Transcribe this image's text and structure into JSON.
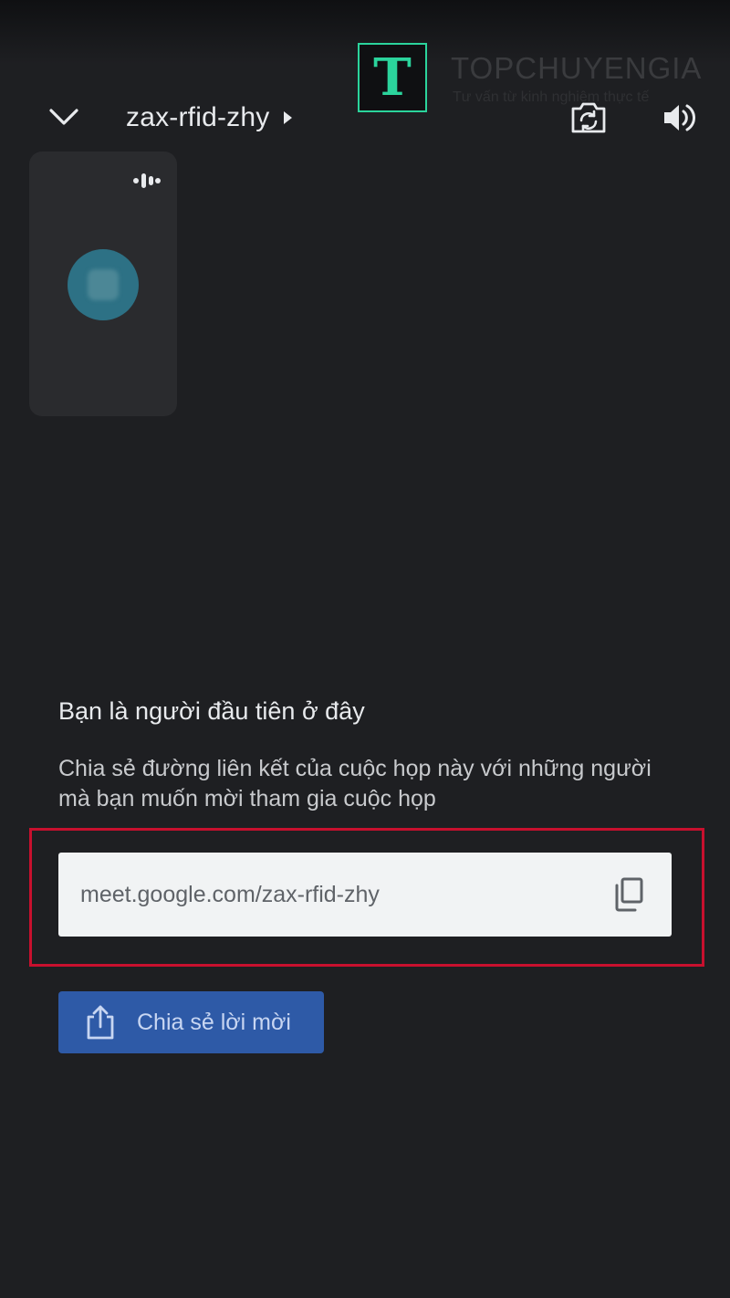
{
  "header": {
    "meeting_code": "zax-rfid-zhy"
  },
  "watermark": {
    "logo_letter": "T",
    "title": "TOPCHUYENGIA",
    "subtitle": "Tư vấn từ kinh nghiệm thực tế",
    "accent_color": "#2bd49c"
  },
  "info": {
    "title": "Bạn là người đầu tiên ở đây",
    "description": "Chia sẻ đường liên kết của cuộc họp này với những người mà bạn muốn mời tham gia cuộc họp"
  },
  "link": {
    "url": "meet.google.com/zax-rfid-zhy"
  },
  "share": {
    "label": "Chia sẻ lời mời"
  },
  "icons": {
    "collapse": "chevron-down-icon",
    "switch_camera": "camera-switch-icon",
    "speaker": "speaker-icon",
    "audio_indicator": "audio-level-icon",
    "copy": "copy-icon",
    "share": "share-icon"
  },
  "colors": {
    "background": "#1e1f22",
    "tile": "#2a2b2e",
    "avatar": "#2d7185",
    "highlight": "#c8102e",
    "share_button": "#2e5aa7"
  }
}
